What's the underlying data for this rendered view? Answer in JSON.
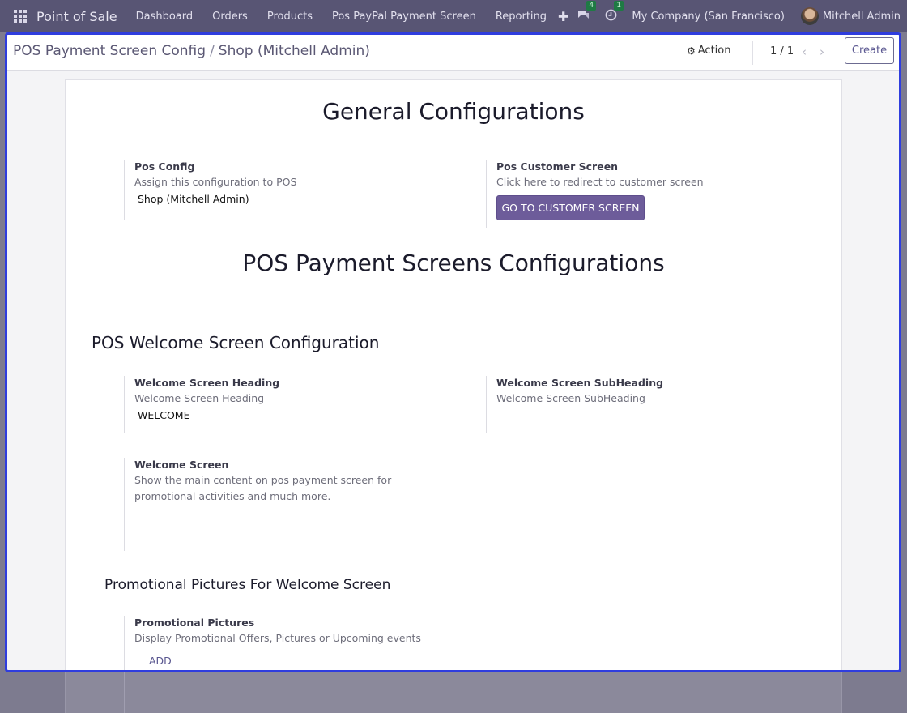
{
  "navbar": {
    "brand": "Point of Sale",
    "menu": [
      "Dashboard",
      "Orders",
      "Products",
      "Pos PayPal Payment Screen",
      "Reporting"
    ],
    "messages_count": "4",
    "activities_count": "1",
    "company": "My Company (San Francisco)",
    "user": "Mitchell Admin"
  },
  "control": {
    "breadcrumb_parent": "POS Payment Screen Config",
    "breadcrumb_separator": "/",
    "breadcrumb_current": "Shop (Mitchell Admin)",
    "action_label": "Action",
    "pager": "1 / 1",
    "create_label": "Create"
  },
  "form": {
    "general_title": "General Configurations",
    "pos_config": {
      "label": "Pos Config",
      "help": "Assign this configuration to POS",
      "value": "Shop (Mitchell Admin)"
    },
    "customer_screen": {
      "label": "Pos Customer Screen",
      "help": "Click here to redirect to customer screen",
      "button": "GO TO CUSTOMER SCREEN"
    },
    "payment_title": "POS Payment Screens Configurations",
    "welcome_section_title": "POS Welcome Screen Configuration",
    "welcome_heading": {
      "label": "Welcome Screen Heading",
      "help": "Welcome Screen Heading",
      "value": "WELCOME"
    },
    "welcome_subheading": {
      "label": "Welcome Screen SubHeading",
      "help": "Welcome Screen SubHeading"
    },
    "welcome_screen": {
      "label": "Welcome Screen",
      "help": "Show the main content on pos payment screen for promotional activities and much more."
    },
    "promo_section_title": "Promotional Pictures For Welcome Screen",
    "promo_pictures": {
      "label": "Promotional Pictures",
      "help": "Display Promotional Offers, Pictures or Upcoming events",
      "add_label": "ADD"
    }
  },
  "colors": {
    "navbar": "#585574",
    "primary": "#6d5c9a",
    "focus_border": "#2f3dde",
    "badge": "#1f7a44"
  }
}
